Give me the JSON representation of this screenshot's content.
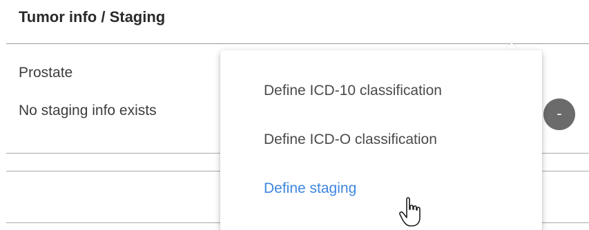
{
  "section": {
    "title": "Tumor info / Staging"
  },
  "tumor": {
    "site": "Prostate",
    "staging_status": "No staging info exists",
    "remove_label": "-"
  },
  "menu": {
    "items": [
      {
        "label": "Define ICD-10 classification",
        "state": "default"
      },
      {
        "label": "Define ICD-O classification",
        "state": "default"
      },
      {
        "label": "Define staging",
        "state": "hover"
      }
    ],
    "hover_color": "#3d86e0"
  },
  "icons": {
    "cursor": "hand-pointer-icon"
  }
}
